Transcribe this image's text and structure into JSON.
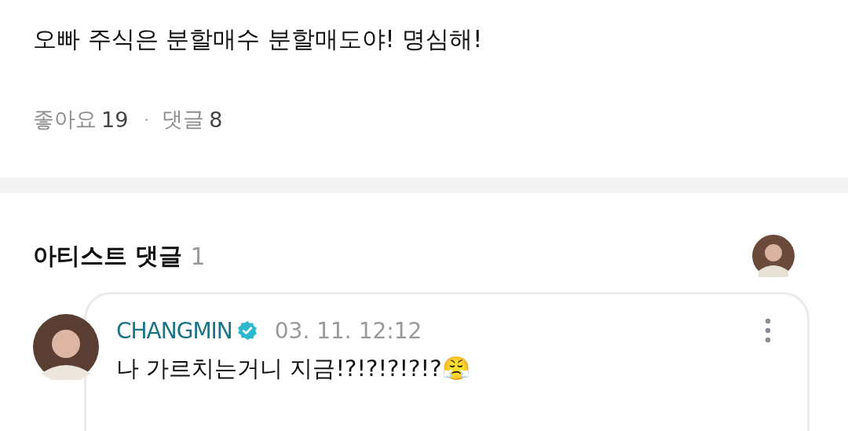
{
  "post": {
    "text": "오빠 주식은 분할매수 분할매도야! 명심해!",
    "stats": [
      {
        "label": "좋아요",
        "count": "19"
      },
      {
        "label": "댓글",
        "count": "8"
      }
    ],
    "separator": "·"
  },
  "artist_comments": {
    "title": "아티스트 댓글",
    "count": "1",
    "comments": [
      {
        "author": "CHANGMIN",
        "verified": true,
        "date": "03. 11. 12:12",
        "text": "나 가르치는거니 지금!?!?!?!?!?😤"
      }
    ]
  }
}
